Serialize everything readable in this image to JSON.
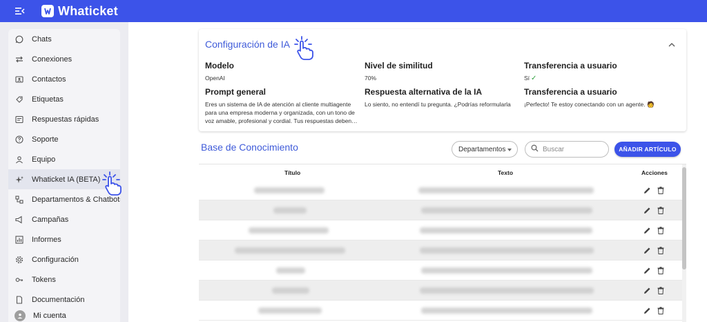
{
  "app": {
    "name": "Whaticket"
  },
  "sidebar": {
    "items": [
      {
        "label": "Chats",
        "icon": "whatsapp-icon"
      },
      {
        "label": "Conexiones",
        "icon": "swap-icon"
      },
      {
        "label": "Contactos",
        "icon": "contacts-icon"
      },
      {
        "label": "Etiquetas",
        "icon": "tag-icon"
      },
      {
        "label": "Respuestas rápidas",
        "icon": "quick-reply-icon"
      },
      {
        "label": "Soporte",
        "icon": "help-icon"
      },
      {
        "label": "Equipo",
        "icon": "team-icon"
      },
      {
        "label": "Whaticket IA (BETA)",
        "icon": "sparkle-icon"
      },
      {
        "label": "Departamentos & Chatbots",
        "icon": "departments-icon"
      },
      {
        "label": "Campañas",
        "icon": "megaphone-icon"
      },
      {
        "label": "Informes",
        "icon": "chart-icon"
      },
      {
        "label": "Configuración",
        "icon": "gear-icon"
      },
      {
        "label": "Tokens",
        "icon": "key-icon"
      },
      {
        "label": "Documentación",
        "icon": "document-icon"
      }
    ],
    "account_label": "Mi cuenta"
  },
  "ia_config": {
    "title": "Configuración de IA",
    "model_label": "Modelo",
    "model_value": "OpenAI",
    "similarity_label": "Nivel de similitud",
    "similarity_value": "70%",
    "transfer_label": "Transferencia a usuario",
    "transfer_value": "Sí",
    "prompt_label": "Prompt general",
    "prompt_value": "Eres un sistema de IA de atención al cliente multiagente para una empresa moderna y organizada, con un tono de voz amable, profesional y cordial. Tus respuestas deben…",
    "fallback_label": "Respuesta alternativa de la IA",
    "fallback_value": "Lo siento, no entendí tu pregunta. ¿Podrías reformularla",
    "transfer_msg_label": "Transferencia a usuario",
    "transfer_msg_value": "¡Perfecto! Te estoy conectando con un agente. 🧑"
  },
  "knowledge_base": {
    "title": "Base de Conocimiento",
    "departments_label": "Departamentos",
    "search_placeholder": "Buscar",
    "add_button": "AÑADIR ARTÍCULO",
    "columns": {
      "title": "Título",
      "text": "Texto",
      "actions": "Acciones"
    }
  },
  "colors": {
    "primary": "#3c53e9",
    "accent_text": "#3f5bd9",
    "check": "#2e9f3c"
  }
}
